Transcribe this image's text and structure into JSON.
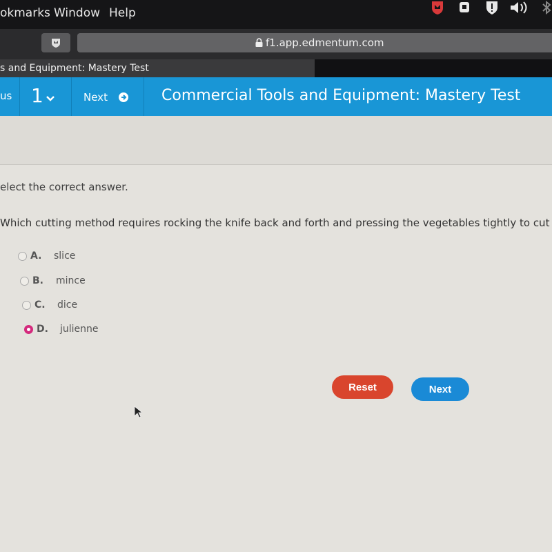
{
  "menubar": {
    "items": [
      "okmarks",
      "Window",
      "Help"
    ]
  },
  "browser": {
    "url": "f1.app.edmentum.com",
    "tab_title": "s and Equipment: Mastery Test"
  },
  "header": {
    "previous_label": "us",
    "question_number": "1",
    "next_label": "Next",
    "title": "Commercial Tools and Equipment: Mastery Test"
  },
  "question": {
    "instruction": "elect the correct answer.",
    "prompt": "Which cutting method requires rocking the knife back and forth and pressing the vegetables tightly to cut the",
    "options": [
      {
        "letter": "A.",
        "text": "slice",
        "selected": false
      },
      {
        "letter": "B.",
        "text": "mince",
        "selected": false
      },
      {
        "letter": "C.",
        "text": "dice",
        "selected": false
      },
      {
        "letter": "D.",
        "text": "julienne",
        "selected": true
      }
    ]
  },
  "actions": {
    "reset_label": "Reset",
    "next_label": "Next",
    "reset_color": "#d9452d",
    "next_color": "#1a8ad6"
  },
  "colors": {
    "header_blue": "#1996d6",
    "selected_radio": "#d42a7d"
  }
}
